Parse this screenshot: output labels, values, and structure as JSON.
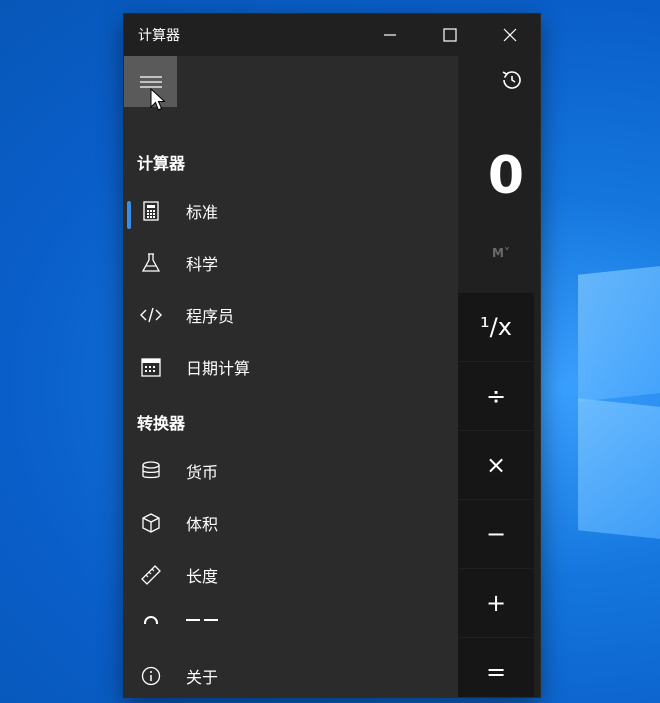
{
  "window": {
    "title": "计算器"
  },
  "nav": {
    "calculator_header": "计算器",
    "converter_header": "转换器",
    "calculator_items": [
      {
        "label": "标准",
        "icon": "calculator-icon",
        "selected": true
      },
      {
        "label": "科学",
        "icon": "flask-icon"
      },
      {
        "label": "程序员",
        "icon": "code-icon"
      },
      {
        "label": "日期计算",
        "icon": "calendar-icon"
      }
    ],
    "converter_items": [
      {
        "label": "货币",
        "icon": "coins-icon"
      },
      {
        "label": "体积",
        "icon": "cube-icon"
      },
      {
        "label": "长度",
        "icon": "ruler-icon"
      }
    ],
    "about": {
      "label": "关于",
      "icon": "info-icon"
    }
  },
  "calc": {
    "display_value": "0",
    "memory_label": "M˅",
    "operators": [
      {
        "label": "¹/x",
        "name": "reciprocal-button"
      },
      {
        "label": "÷",
        "name": "divide-button"
      },
      {
        "label": "×",
        "name": "multiply-button"
      },
      {
        "label": "−",
        "name": "subtract-button"
      },
      {
        "label": "+",
        "name": "add-button"
      },
      {
        "label": "=",
        "name": "equals-button"
      }
    ]
  },
  "colors": {
    "accent": "#3b8ee8",
    "window_bg": "#202020",
    "pane_bg": "#2b2b2b",
    "desktop": "#0a5ec9"
  }
}
